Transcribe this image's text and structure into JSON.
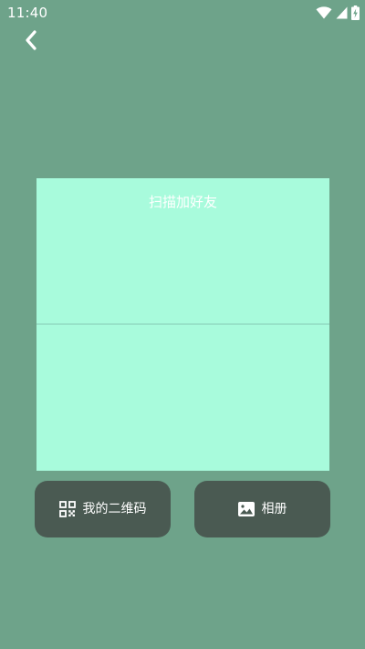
{
  "status_bar": {
    "time": "11:40",
    "icons": [
      "wifi-icon",
      "signal-icon",
      "battery-charging-icon"
    ]
  },
  "nav": {
    "back_icon": "chevron-left-icon"
  },
  "scanner": {
    "title": "扫描加好友"
  },
  "actions": {
    "my_qr_label": "我的二维码",
    "my_qr_icon": "qr-code-icon",
    "album_label": "相册",
    "album_icon": "image-icon"
  },
  "colors": {
    "background": "#6ea38a",
    "scan_frame": "#a8fbdc",
    "scan_line": "#86c9b4",
    "button_bg": "#4a5a52"
  }
}
